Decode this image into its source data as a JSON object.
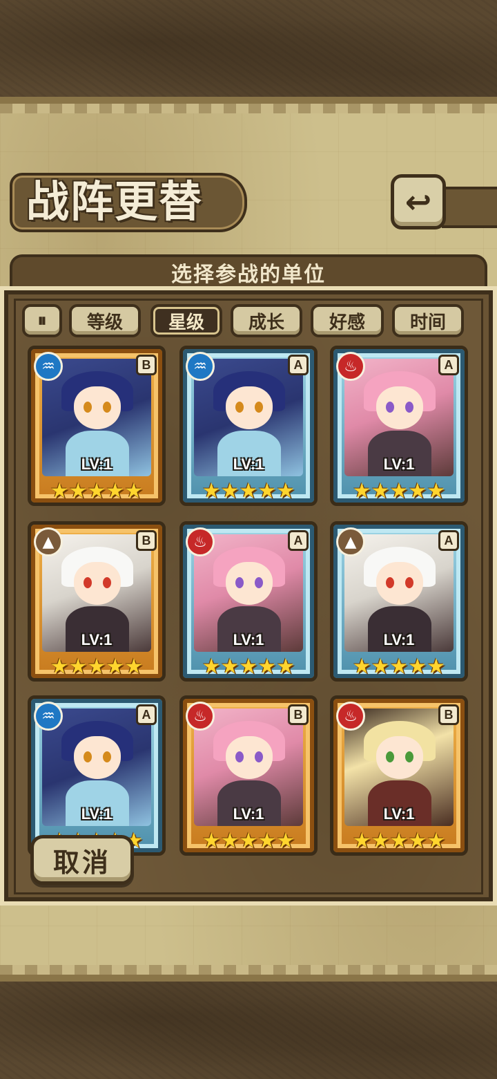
{
  "header": {
    "title": "战阵更替",
    "back_icon": "↩"
  },
  "panel": {
    "heading": "选择参战的单位"
  },
  "sort_tabs": {
    "toggle_icon": "⏸",
    "items": [
      {
        "label": "等级",
        "active": false
      },
      {
        "label": "星级",
        "active": true
      },
      {
        "label": "成长",
        "active": false
      },
      {
        "label": "好感",
        "active": false
      },
      {
        "label": "时间",
        "active": false
      }
    ]
  },
  "units": [
    {
      "element": "water",
      "element_icon": "♒",
      "rank": "B",
      "level": "LV:1",
      "stars": "★★★★★",
      "frame": "gold",
      "character": "elf"
    },
    {
      "element": "water",
      "element_icon": "♒",
      "rank": "A",
      "level": "LV:1",
      "stars": "★★★★★",
      "frame": "blue",
      "character": "elf"
    },
    {
      "element": "fire",
      "element_icon": "♨",
      "rank": "A",
      "level": "LV:1",
      "stars": "★★★★★",
      "frame": "blue",
      "character": "pink"
    },
    {
      "element": "earth",
      "element_icon": "▲",
      "rank": "B",
      "level": "LV:1",
      "stars": "★★★★★",
      "frame": "gold",
      "character": "white"
    },
    {
      "element": "fire",
      "element_icon": "♨",
      "rank": "A",
      "level": "LV:1",
      "stars": "★★★★★",
      "frame": "blue",
      "character": "pink"
    },
    {
      "element": "earth",
      "element_icon": "▲",
      "rank": "A",
      "level": "LV:1",
      "stars": "★★★★★",
      "frame": "blue",
      "character": "white"
    },
    {
      "element": "water",
      "element_icon": "♒",
      "rank": "A",
      "level": "LV:1",
      "stars": "★★★★★",
      "frame": "blue",
      "character": "elf"
    },
    {
      "element": "fire",
      "element_icon": "♨",
      "rank": "B",
      "level": "LV:1",
      "stars": "★★★★★",
      "frame": "gold",
      "character": "pink"
    },
    {
      "element": "fire",
      "element_icon": "♨",
      "rank": "B",
      "level": "LV:1",
      "stars": "★★★★★",
      "frame": "gold",
      "character": "blonde"
    }
  ],
  "footer": {
    "cancel_label": "取消"
  },
  "colors": {
    "gold_frame": "#f0b24a",
    "blue_frame": "#9fd6e6",
    "water": "#1f78c4",
    "fire": "#c62828",
    "earth": "#7a5a3a",
    "star": "#ffd52e"
  }
}
